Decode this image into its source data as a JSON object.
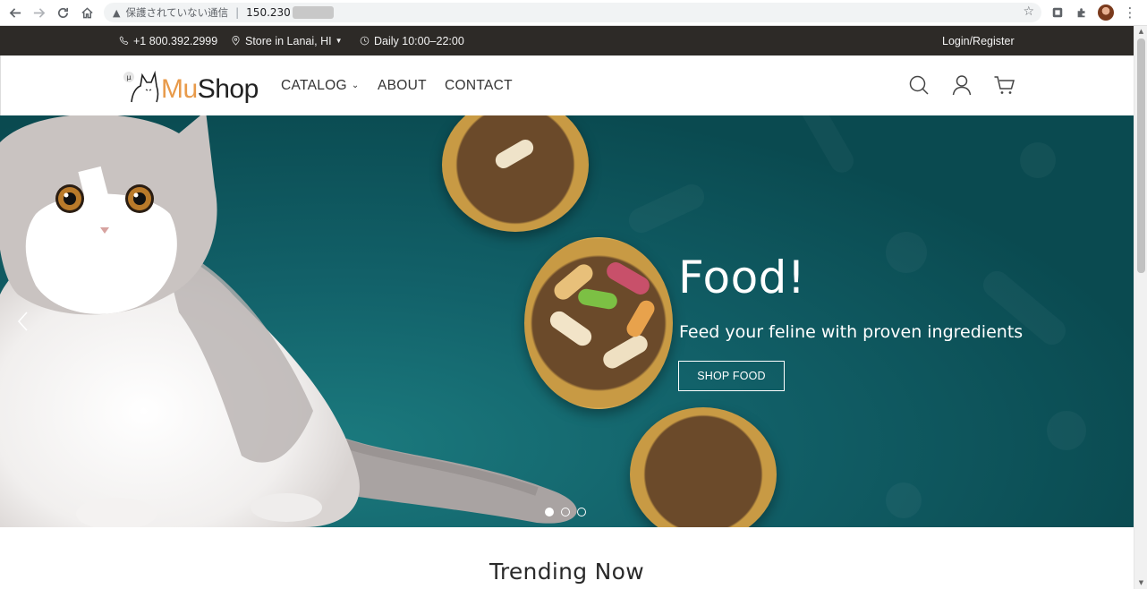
{
  "browser": {
    "security_text": "保護されていない通信",
    "url_text": "150.230",
    "menu_icon": "⋮"
  },
  "topbar": {
    "phone": "+1 800.392.2999",
    "store": "Store in Lanai, HI",
    "hours": "Daily 10:00–22:00",
    "login": "Login/Register"
  },
  "header": {
    "logo_mu": "Mu",
    "logo_shop": "Shop",
    "menu": {
      "catalog": "CATALOG",
      "about": "ABOUT",
      "contact": "CONTACT"
    }
  },
  "hero": {
    "title": "Food!",
    "subtitle": "Feed your feline with proven ingredients",
    "cta": "SHOP FOOD",
    "active_slide": 1,
    "slide_count": 3
  },
  "section": {
    "trending_title": "Trending Now"
  },
  "colors": {
    "topbar_bg": "#2d2a27",
    "hero_bg": "#0d4d52",
    "logo_accent": "#e89a4a"
  }
}
